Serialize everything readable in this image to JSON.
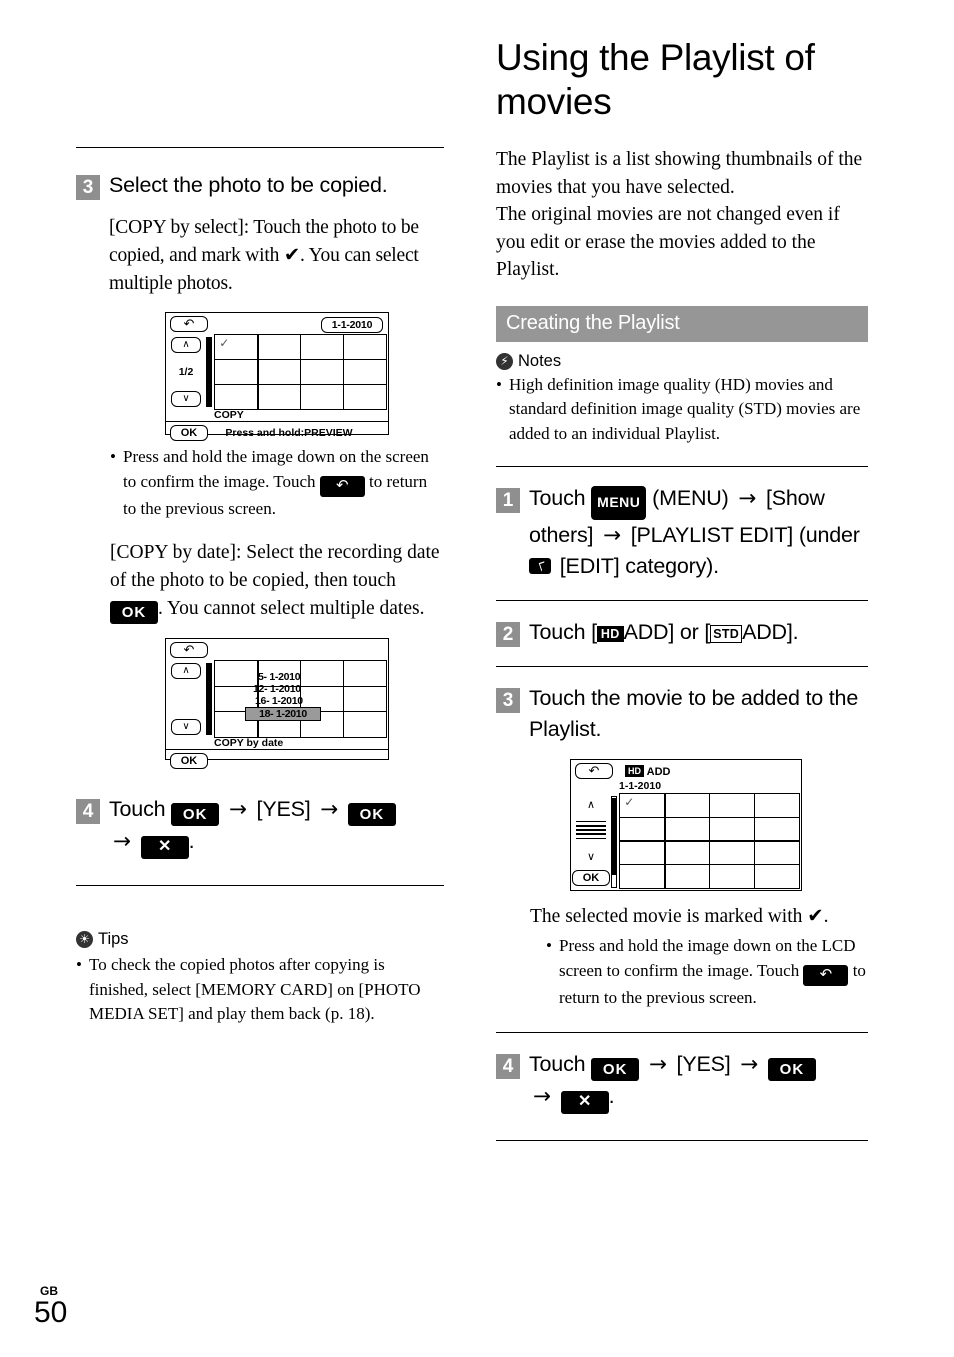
{
  "footer": {
    "lang": "GB",
    "page_number": "50"
  },
  "left_column": {
    "step3": {
      "number": "3",
      "title": "Select the photo to be copied.",
      "para_select": "[COPY by select]: Touch the photo to be copied, and mark with ✔. You can select multiple photos.",
      "lcd_select": {
        "back_label": "↶",
        "date_label": "1-1-2010",
        "up_label": "∧",
        "down_label": "∨",
        "page_indicator": "1/2",
        "check_mark": "✓",
        "mode_label": "COPY",
        "ok_label": "OK",
        "hint": "Press and hold:PREVIEW"
      },
      "bullet_preview": {
        "part1": "Press and hold the image down on the screen to confirm the image. Touch",
        "key": "↶",
        "part2": "to return to the previous screen."
      },
      "para_date": {
        "part1": "[COPY by date]: Select the recording date of the photo to be copied, then touch",
        "key": "OK",
        "part2": ". You cannot select multiple dates."
      },
      "lcd_date": {
        "back_label": "↶",
        "up_label": "∧",
        "down_label": "∨",
        "dates": [
          "5- 1-2010",
          "12- 1-2010",
          "16- 1-2010",
          "18- 1-2010"
        ],
        "selected_date": "18- 1-2010",
        "mode_label": "COPY by date",
        "ok_label": "OK"
      }
    },
    "step4": {
      "number": "4",
      "touch_label": "Touch",
      "key_ok_1": "OK",
      "arrow": "→",
      "yes_label": "[YES]",
      "key_ok_2": "OK",
      "key_close": "✕",
      "period": "."
    },
    "tips": {
      "icon": "☀",
      "heading": "Tips",
      "bullet": "To check the copied photos after copying is finished, select [MEMORY CARD] on [PHOTO MEDIA SET] and play them back (p. 18)."
    }
  },
  "right_column": {
    "title": "Using the Playlist of movies",
    "intro_line1": "The Playlist is a list showing thumbnails of the movies that you have selected.",
    "intro_line2": "The original movies are not changed even if you edit or erase the movies added to the Playlist.",
    "section_header": "Creating the Playlist",
    "notes": {
      "icon": "⚡",
      "heading": "Notes",
      "bullet": "High definition image quality (HD) movies and standard definition image quality (STD) movies are added to an individual Playlist."
    },
    "step1": {
      "number": "1",
      "touch_label": "Touch",
      "key_menu": "MENU",
      "menu_paren": "(MENU)",
      "arrow": "→",
      "show_others": "[Show others]",
      "playlist_edit": "[PLAYLIST EDIT]",
      "under_label": "(under",
      "edit_category": "[EDIT] category)."
    },
    "step2": {
      "number": "2",
      "touch_label": "Touch [",
      "hd_badge": "HD",
      "add_label_1": "ADD] or [",
      "std_badge": "STD",
      "add_label_2": "ADD]."
    },
    "step3": {
      "number": "3",
      "title": "Touch the movie to be added to the Playlist.",
      "lcd_add": {
        "back_label": "↶",
        "hd_badge": "HD",
        "add_title": "ADD",
        "date_label": "1-1-2010",
        "up_label": "∧",
        "down_label": "∨",
        "check_mark": "✓",
        "ok_label": "OK"
      },
      "marked_text": "The selected movie is marked with ✔.",
      "bullet_preview": {
        "part1": "Press and hold the image down on the LCD screen to confirm the image. Touch",
        "key": "↶",
        "part2": "to return to the previous screen."
      }
    },
    "step4": {
      "number": "4",
      "touch_label": "Touch",
      "key_ok_1": "OK",
      "arrow": "→",
      "yes_label": "[YES]",
      "key_ok_2": "OK",
      "key_close": "✕",
      "period": "."
    }
  }
}
